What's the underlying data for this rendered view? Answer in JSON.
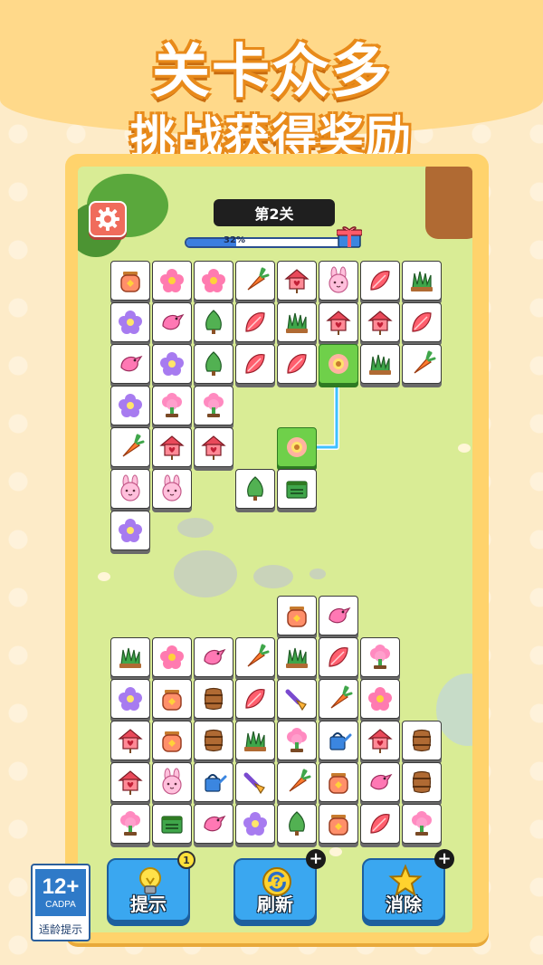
{
  "headline": {
    "line1": "关卡众多",
    "line2": "挑战获得奖励"
  },
  "hud": {
    "level_label": "第2关",
    "progress_percent": 32,
    "progress_text": "32%"
  },
  "tiles": [
    {
      "icon": "honey-jar"
    },
    {
      "icon": "pink-flower"
    },
    {
      "icon": "pink-flower"
    },
    {
      "icon": "carrot"
    },
    {
      "icon": "birdhouse"
    },
    {
      "icon": "bunny"
    },
    {
      "icon": "red-leaf"
    },
    {
      "icon": "grass"
    },
    {
      "icon": "purple-flower"
    },
    {
      "icon": "pink-bird"
    },
    {
      "icon": "green-tree"
    },
    {
      "icon": "red-leaf"
    },
    {
      "icon": "grass"
    },
    {
      "icon": "birdhouse"
    },
    {
      "icon": "birdhouse"
    },
    {
      "icon": "red-leaf"
    },
    {
      "icon": "pink-bird"
    },
    {
      "icon": "purple-flower"
    },
    {
      "icon": "green-tree"
    },
    {
      "icon": "red-leaf"
    },
    {
      "icon": "red-leaf"
    },
    {
      "icon": "sunflower",
      "selected": true
    },
    {
      "icon": "grass"
    },
    {
      "icon": "carrot"
    },
    {
      "icon": "purple-flower"
    },
    {
      "icon": "pink-shrub"
    },
    {
      "icon": "pink-shrub"
    },
    {
      "icon": "carrot"
    },
    {
      "icon": "birdhouse"
    },
    {
      "icon": "birdhouse"
    },
    {
      "icon": "sunflower",
      "selected": true
    },
    {
      "icon": "bunny"
    },
    {
      "icon": "bunny"
    },
    {
      "icon": "green-tree"
    },
    {
      "icon": "seed-box"
    },
    {
      "icon": "purple-flower"
    },
    {
      "icon": "honey-jar"
    },
    {
      "icon": "pink-bird"
    },
    {
      "icon": "grass"
    },
    {
      "icon": "pink-flower"
    },
    {
      "icon": "pink-bird"
    },
    {
      "icon": "carrot"
    },
    {
      "icon": "grass"
    },
    {
      "icon": "red-leaf"
    },
    {
      "icon": "pink-shrub"
    },
    {
      "icon": "purple-flower"
    },
    {
      "icon": "honey-jar"
    },
    {
      "icon": "wood-barrel"
    },
    {
      "icon": "red-leaf"
    },
    {
      "icon": "trowel"
    },
    {
      "icon": "carrot"
    },
    {
      "icon": "pink-flower"
    },
    {
      "icon": "birdhouse"
    },
    {
      "icon": "honey-jar"
    },
    {
      "icon": "wood-barrel"
    },
    {
      "icon": "grass"
    },
    {
      "icon": "pink-shrub"
    },
    {
      "icon": "watering-can"
    },
    {
      "icon": "birdhouse"
    },
    {
      "icon": "wood-barrel"
    },
    {
      "icon": "birdhouse"
    },
    {
      "icon": "bunny"
    },
    {
      "icon": "watering-can"
    },
    {
      "icon": "trowel"
    },
    {
      "icon": "carrot"
    },
    {
      "icon": "honey-jar"
    },
    {
      "icon": "pink-bird"
    },
    {
      "icon": "wood-barrel"
    },
    {
      "icon": "pink-shrub"
    },
    {
      "icon": "seed-box"
    },
    {
      "icon": "pink-bird"
    },
    {
      "icon": "purple-flower"
    },
    {
      "icon": "green-tree"
    },
    {
      "icon": "honey-jar"
    },
    {
      "icon": "red-leaf"
    },
    {
      "icon": "pink-shrub"
    }
  ],
  "tools": [
    {
      "label": "提示",
      "icon": "lightbulb-icon",
      "count": "1"
    },
    {
      "label": "刷新",
      "icon": "refresh-icon",
      "count": "+"
    },
    {
      "label": "消除",
      "icon": "star-icon",
      "count": "+"
    }
  ],
  "age_rating": {
    "age": "12+",
    "org": "CADPA",
    "tip": "适龄提示"
  },
  "colors": {
    "tile_selected": "#6fd04a",
    "tool_button": "#3aa7f0",
    "progress_fill": "#3b7ee0",
    "frame": "#ffd36c"
  }
}
